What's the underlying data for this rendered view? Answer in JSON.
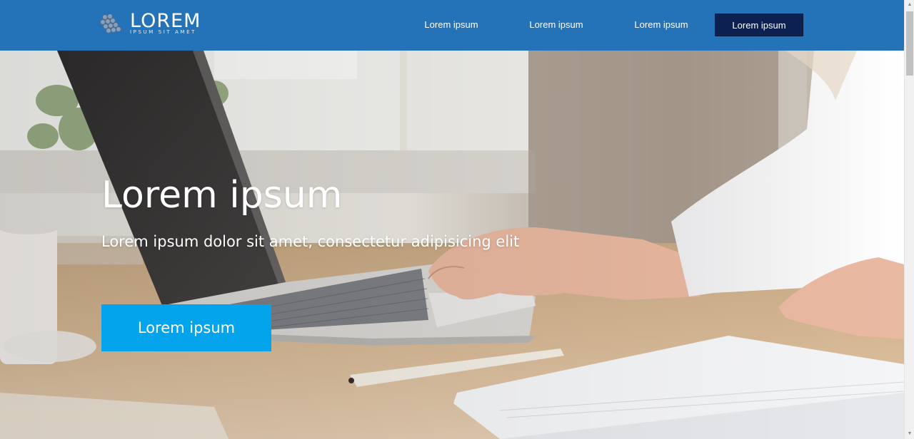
{
  "brand": {
    "name": "LOREM",
    "tagline": "IPSUM SIT AMET"
  },
  "nav": {
    "items": [
      {
        "label": "Lorem ipsum"
      },
      {
        "label": "Lorem ipsum"
      },
      {
        "label": "Lorem ipsum"
      }
    ],
    "cta_label": "Lorem ipsum"
  },
  "hero": {
    "title": "Lorem ipsum",
    "subtitle": "Lorem ipsum dolor sit amet, consectetur adipisicing elit",
    "button_label": "Lorem ipsum",
    "background": "photo-of-person-typing-on-laptop"
  },
  "colors": {
    "header": "#2473b8",
    "nav_cta": "#0c2150",
    "hero_button": "#03a4ec",
    "text": "#ffffff"
  },
  "icons": {
    "logo": "hexagon-cluster-logo",
    "scroll_up": "scroll-up-arrow",
    "scroll_down": "scroll-down-arrow"
  }
}
